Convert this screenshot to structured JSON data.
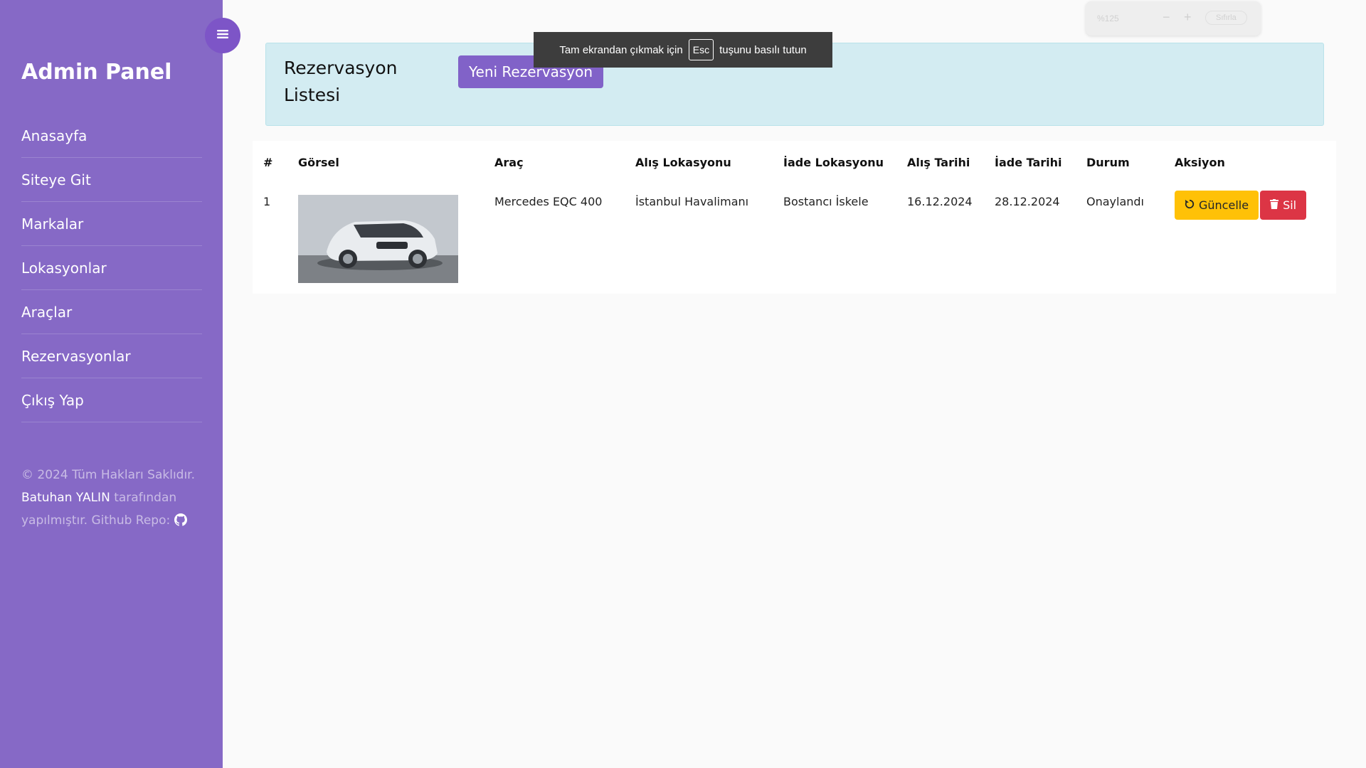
{
  "sidebar": {
    "brand": "Admin Panel",
    "items": [
      {
        "label": "Anasayfa"
      },
      {
        "label": "Siteye Git"
      },
      {
        "label": "Markalar"
      },
      {
        "label": "Lokasyonlar"
      },
      {
        "label": "Araçlar"
      },
      {
        "label": "Rezervasyonlar"
      },
      {
        "label": "Çıkış Yap"
      }
    ],
    "footer": {
      "line1": "© 2024 Tüm Hakları Saklıdır.",
      "author": "Batuhan YALIN",
      "line2": " tarafından yapılmıştır. Github Repo: "
    }
  },
  "header": {
    "title": "Rezervasyon Listesi",
    "new_button": "Yeni Rezervasyon"
  },
  "table": {
    "columns": [
      "#",
      "Görsel",
      "Araç",
      "Alış Lokasyonu",
      "İade Lokasyonu",
      "Alış Tarihi",
      "İade Tarihi",
      "Durum",
      "Aksiyon"
    ],
    "rows": [
      {
        "no": "1",
        "vehicle": "Mercedes EQC 400",
        "pickup": "İstanbul Havalimanı",
        "return": "Bostancı İskele",
        "pickup_date": "16.12.2024",
        "return_date": "28.12.2024",
        "status": "Onaylandı",
        "update_label": "Güncelle",
        "delete_label": "Sil"
      }
    ]
  },
  "fullscreen_notice": {
    "before": "Tam ekrandan çıkmak için",
    "key": "Esc",
    "after": "tuşunu basılı tutun"
  },
  "zoom": {
    "level": "%125",
    "minus": "−",
    "plus": "+",
    "reset": "Sıfırla"
  },
  "colors": {
    "sidebar": "#8669c6",
    "primary": "#8162c8",
    "warning": "#ffc107",
    "danger": "#dc3545",
    "header_bg": "#d3ecf2"
  }
}
